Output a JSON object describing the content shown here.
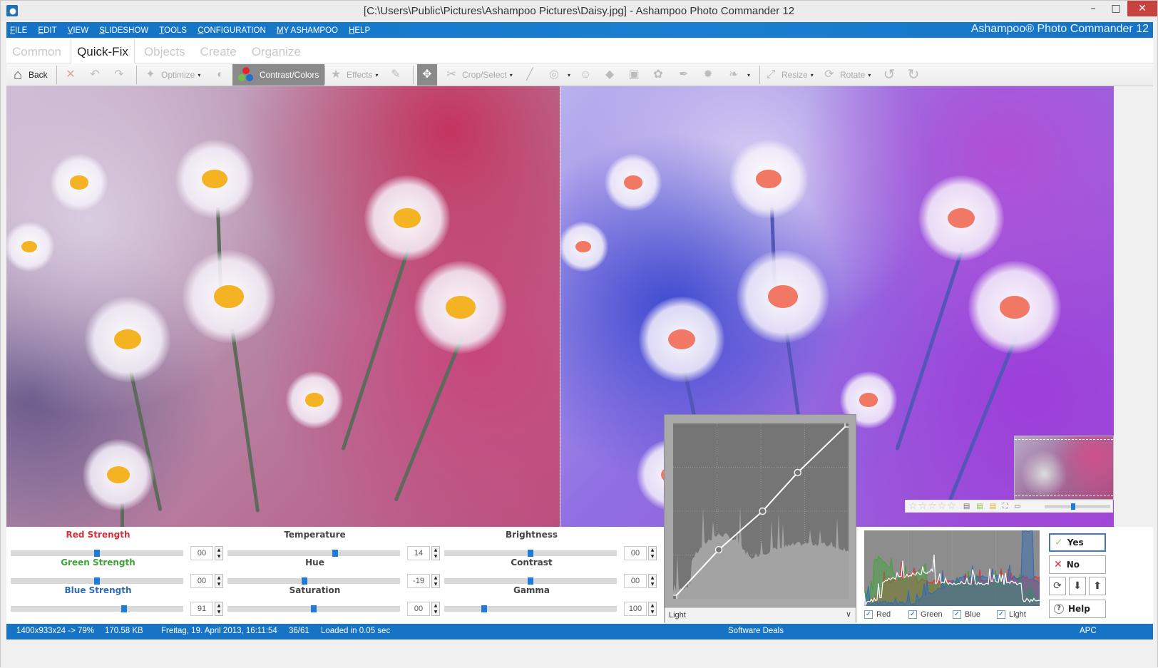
{
  "window": {
    "title": "[C:\\Users\\Public\\Pictures\\Ashampoo Pictures\\Daisy.jpg] - Ashampoo Photo Commander 12",
    "minimize_icon": "minimize-icon",
    "maximize_icon": "maximize-icon",
    "close_icon": "close-icon",
    "min_glyph": "–",
    "max_glyph": "□",
    "close_glyph": "✕"
  },
  "menu": {
    "items": [
      {
        "u": "F",
        "rest": "ILE"
      },
      {
        "u": "E",
        "rest": "DIT"
      },
      {
        "u": "V",
        "rest": "IEW"
      },
      {
        "u": "S",
        "rest": "LIDESHOW"
      },
      {
        "u": "T",
        "rest": "OOLS"
      },
      {
        "u": "C",
        "rest": "ONFIGURATION"
      },
      {
        "u": "M",
        "rest": "Y ASHAMPOO"
      },
      {
        "u": "H",
        "rest": "ELP"
      }
    ],
    "brand": "Ashampoo® Photo Commander 12"
  },
  "tabs": [
    {
      "label": "Common",
      "active": false
    },
    {
      "label": "Quick-Fix",
      "active": true
    },
    {
      "label": "Objects",
      "active": false
    },
    {
      "label": "Create",
      "active": false
    },
    {
      "label": "Organize",
      "active": false
    }
  ],
  "toolbar": {
    "back_label": "Back",
    "optimize_label": "Optimize",
    "contrast_label": "Contrast/Colors",
    "effects_label": "Effects",
    "crop_label": "Crop/Select",
    "resize_label": "Resize",
    "rotate_label": "Rotate",
    "caret": "▾",
    "icons": {
      "home": "⌂",
      "discard": "✕",
      "undo": "↶",
      "redo": "↷",
      "wand": "✦",
      "exposure": "◐",
      "stars": "★",
      "brush": "✎",
      "select_hand": "✥",
      "scissors": "✂",
      "line": "╱",
      "eye": "◎",
      "person": "☺",
      "eraser": "◆",
      "frame": "▣",
      "paint": "✿",
      "pen": "✒",
      "splash": "✹",
      "link": "❧",
      "resize": "⤢",
      "rotate": "⟳",
      "rot_left": "↺",
      "rot_right": "↻"
    }
  },
  "sliders": [
    {
      "label": "Red Strength",
      "value": "00",
      "position": 0.5,
      "color": "#d9303a"
    },
    {
      "label": "Green Strength",
      "value": "00",
      "position": 0.5,
      "color": "#3fa33a"
    },
    {
      "label": "Blue Strength",
      "value": "91",
      "position": 0.655,
      "color": "#2e6bb5"
    },
    {
      "label": "Temperature",
      "value": "14",
      "position": 0.625,
      "color": "#444444"
    },
    {
      "label": "Hue",
      "value": "-19",
      "position": 0.445,
      "color": "#444444"
    },
    {
      "label": "Saturation",
      "value": "00",
      "position": 0.5,
      "color": "#444444"
    },
    {
      "label": "Brightness",
      "value": "00",
      "position": 0.5,
      "color": "#444444"
    },
    {
      "label": "Contrast",
      "value": "00",
      "position": 0.5,
      "color": "#444444"
    },
    {
      "label": "Gamma",
      "value": "100",
      "position": 0.23,
      "color": "#444444"
    }
  ],
  "spin": {
    "up": "▲",
    "down": "▼"
  },
  "curve": {
    "channel": "Light",
    "chevron": "∨",
    "points": [
      [
        0,
        0
      ],
      [
        0.26,
        0.28
      ],
      [
        0.51,
        0.5
      ],
      [
        0.71,
        0.72
      ],
      [
        1,
        1
      ]
    ]
  },
  "navigator": {
    "rating_stars": 0,
    "star_glyph": "☆",
    "icons": [
      "▤",
      "▤",
      "▤",
      "⛶",
      "▭"
    ],
    "zoom_position": 0.4
  },
  "histogram": {
    "channels": [
      {
        "label": "Red",
        "checked": true,
        "color": "#d9303a"
      },
      {
        "label": "Green",
        "checked": true,
        "color": "#3fa33a"
      },
      {
        "label": "Blue",
        "checked": true,
        "color": "#2e6bb5"
      },
      {
        "label": "Light",
        "checked": true,
        "color": "#ffffff"
      }
    ],
    "check_glyph": "✓"
  },
  "actions": {
    "yes_label": "Yes",
    "no_label": "No",
    "help_label": "Help",
    "yes_icon": "✓",
    "no_icon": "✕",
    "help_icon": "?",
    "refresh_icon": "⟳",
    "save_down_icon": "⬇",
    "save_up_icon": "⬆"
  },
  "status": {
    "dimensions": "1400x933x24 -> 79%",
    "filesize": "170.58 KB",
    "date": "Freitag, 19. April 2013, 16:11:54",
    "index": "36/61",
    "loaded": "Loaded in 0.05 sec",
    "deals": "Software Deals",
    "apc": "APC"
  }
}
